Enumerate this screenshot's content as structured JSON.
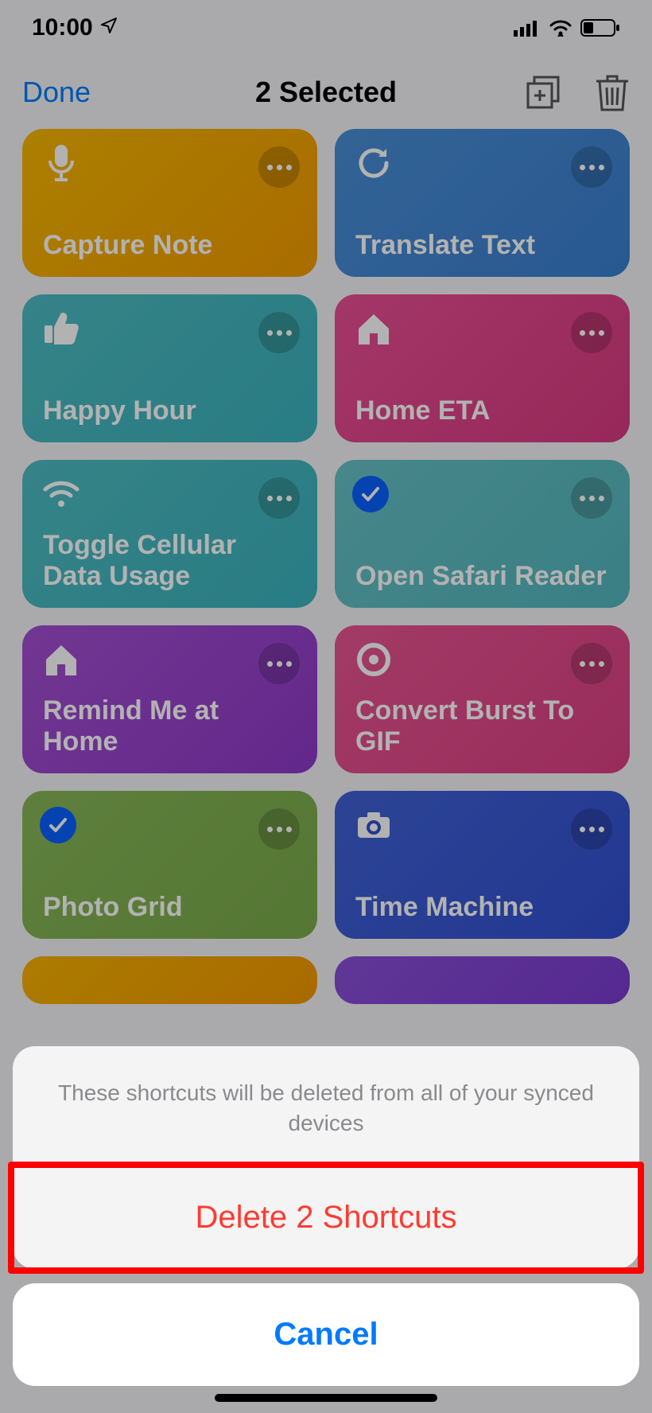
{
  "statusbar": {
    "time": "10:00"
  },
  "nav": {
    "done": "Done",
    "title": "2 Selected"
  },
  "cards": [
    {
      "label": "Capture Note",
      "icon": "mic",
      "color": "g-yellow",
      "selected": false
    },
    {
      "label": "Translate Text",
      "icon": "cycle",
      "color": "g-blue",
      "selected": false
    },
    {
      "label": "Happy Hour",
      "icon": "thumbsup",
      "color": "g-teal",
      "selected": false
    },
    {
      "label": "Home ETA",
      "icon": "home",
      "color": "g-pink",
      "selected": false
    },
    {
      "label": "Toggle Cellular Data Usage",
      "icon": "wifi",
      "color": "g-teal2",
      "selected": false
    },
    {
      "label": "Open Safari Reader",
      "icon": "check",
      "color": "g-ltteal",
      "selected": true
    },
    {
      "label": "Remind Me at Home",
      "icon": "home",
      "color": "g-purple",
      "selected": false
    },
    {
      "label": "Convert Burst To GIF",
      "icon": "target",
      "color": "g-rose",
      "selected": false
    },
    {
      "label": "Photo Grid",
      "icon": "check",
      "color": "g-green",
      "selected": true
    },
    {
      "label": "Time Machine",
      "icon": "camera",
      "color": "g-indigo",
      "selected": false
    }
  ],
  "peek": [
    {
      "color": "g-orange"
    },
    {
      "color": "g-violet"
    }
  ],
  "sheet": {
    "message": "These shortcuts will be deleted from all of your synced devices",
    "destructive": "Delete 2 Shortcuts",
    "cancel": "Cancel"
  }
}
